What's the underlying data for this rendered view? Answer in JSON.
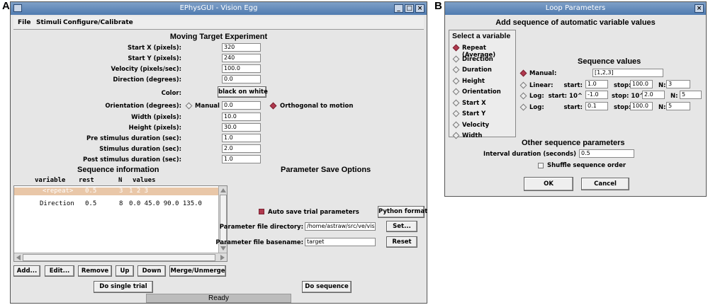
{
  "panels": {
    "a": "A",
    "b": "B"
  },
  "main": {
    "title": "EPhysGUI - Vision Egg",
    "menu": [
      "File",
      "Stimuli",
      "Configure/Calibrate"
    ],
    "heading": "Moving Target Experiment",
    "params": [
      {
        "label": "Start X (pixels):",
        "value": "320"
      },
      {
        "label": "Start Y (pixels):",
        "value": "240"
      },
      {
        "label": "Velocity (pixels/sec):",
        "value": "100.0"
      },
      {
        "label": "Direction (degrees):",
        "value": "0.0"
      }
    ],
    "color_label": "Color:",
    "color_button": "black on white",
    "orientation": {
      "label": "Orientation (degrees):",
      "manual": "Manual",
      "value": "0.0",
      "orthogonal": "Orthogonal to motion"
    },
    "params2": [
      {
        "label": "Width (pixels):",
        "value": "10.0"
      },
      {
        "label": "Height (pixels):",
        "value": "30.0"
      },
      {
        "label": "Pre stimulus duration (sec):",
        "value": "1.0"
      },
      {
        "label": "Stimulus duration (sec):",
        "value": "2.0"
      },
      {
        "label": "Post stimulus duration (sec):",
        "value": "1.0"
      }
    ],
    "sequence": {
      "heading": "Sequence information",
      "columns": {
        "variable": "variable",
        "rest": "rest",
        "n": "N",
        "values": "values"
      },
      "rows": [
        {
          "variable": "<repeat>",
          "rest": "0.5",
          "n": "3",
          "values": "1 2 3"
        },
        {
          "variable": "Direction",
          "rest": "0.5",
          "n": "8",
          "values": "0.0 45.0 90.0 135.0"
        }
      ],
      "buttons": [
        "Add...",
        "Edit...",
        "Remove",
        "Up",
        "Down",
        "Merge/Unmerge"
      ]
    },
    "save": {
      "heading": "Parameter Save Options",
      "auto_save": "Auto save trial parameters",
      "python_format": "Python format",
      "dir_label": "Parameter file directory:",
      "dir_value": "/home/astraw/src/ve/visic",
      "set_button": "Set...",
      "base_label": "Parameter file basename:",
      "base_value": "target",
      "reset_button": "Reset"
    },
    "do_single": "Do single trial",
    "do_sequence": "Do sequence",
    "status": "Ready"
  },
  "loop": {
    "title": "Loop Parameters",
    "heading": "Add sequence of automatic variable values",
    "select_heading": "Select a variable",
    "variables": [
      "Repeat (Average)",
      "Direction",
      "Duration",
      "Height",
      "Orientation",
      "Start X",
      "Start Y",
      "Velocity",
      "Width"
    ],
    "selected_variable": 0,
    "seq_heading": "Sequence values",
    "manual": {
      "label": "Manual:",
      "value": "[1,2,3]"
    },
    "linear": {
      "label": "Linear:",
      "start_label": "start:",
      "start": "1.0",
      "stop_label": "stop:",
      "stop": "100.0",
      "n_label": "N:",
      "n": "3"
    },
    "log10": {
      "label": "Log:",
      "start_label": "start: 10^",
      "start": "-1.0",
      "stop_label": "stop: 10^",
      "stop": "2.0",
      "n_label": "N:",
      "n": "5"
    },
    "log": {
      "label": "Log:",
      "start_label": "start:",
      "start": "0.1",
      "stop_label": "stop:",
      "stop": "100.0",
      "n_label": "N:",
      "n": "5"
    },
    "other_heading": "Other sequence parameters",
    "interval_label": "Interval duration (seconds)",
    "interval_value": "0.5",
    "shuffle": "Shuffle sequence order",
    "ok": "OK",
    "cancel": "Cancel"
  }
}
